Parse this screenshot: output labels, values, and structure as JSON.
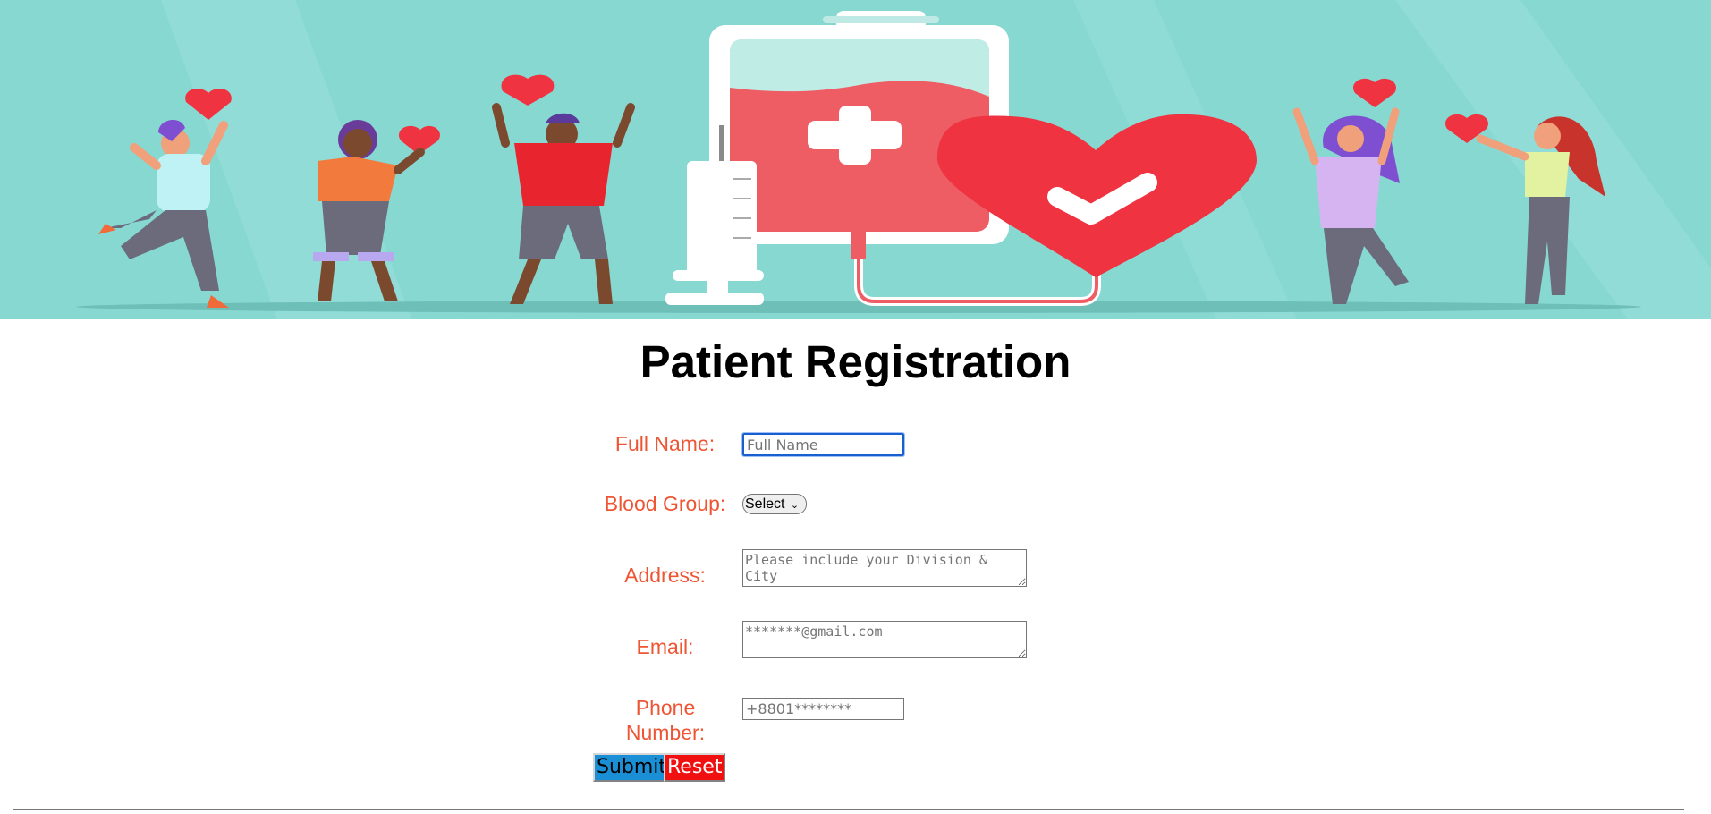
{
  "page": {
    "title": "Patient Registration"
  },
  "form": {
    "full_name": {
      "label": "Full Name:",
      "placeholder": "Full Name",
      "value": ""
    },
    "blood_group": {
      "label": "Blood Group:",
      "selected": "Select"
    },
    "address": {
      "label": "Address:",
      "placeholder": "Please include your Division & City"
    },
    "email": {
      "label": "Email:",
      "placeholder": "*******@gmail.com"
    },
    "phone": {
      "label": "Phone Number:",
      "placeholder": "+8801********"
    },
    "submit_label": "Submit",
    "reset_label": "Reset"
  },
  "colors": {
    "banner_bg": "#88d8d2",
    "label_color": "#ee5533",
    "submit_bg": "#1b8fd6",
    "reset_bg": "#f01010",
    "heart_red": "#ef3340"
  },
  "icons": {
    "banner": "blood-donation-illustration",
    "select": "chevron-down-icon"
  }
}
